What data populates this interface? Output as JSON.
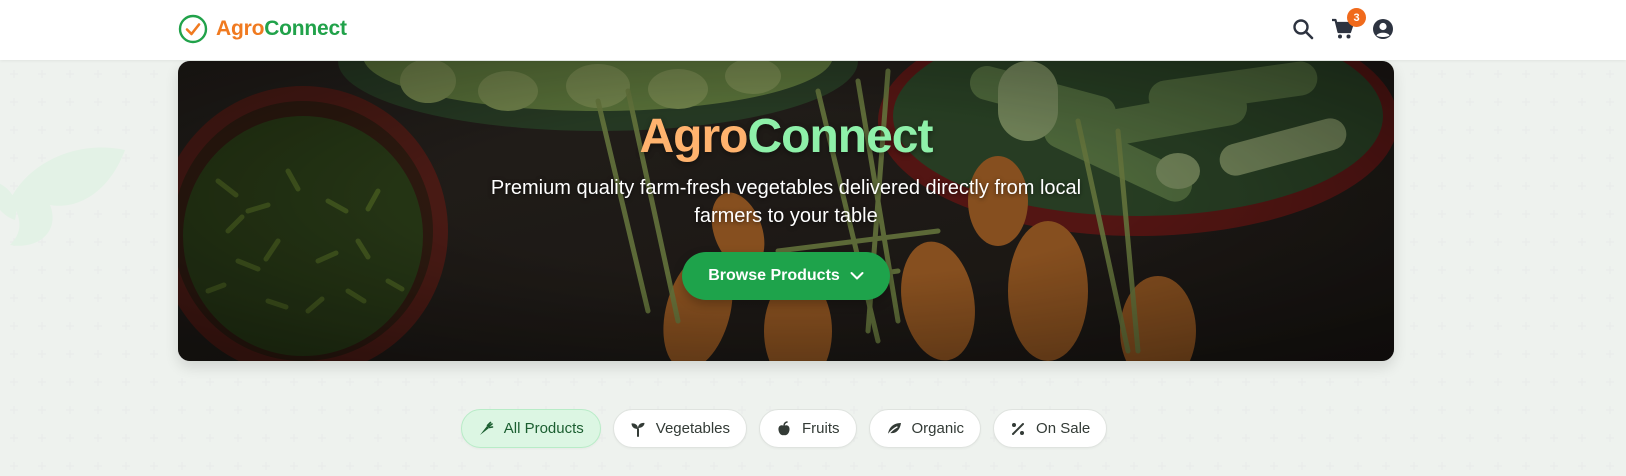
{
  "brand": {
    "name_part1": "Agro",
    "name_part2": "Connect",
    "accent_orange": "#f07a20",
    "accent_green": "#21a24a"
  },
  "header": {
    "icons": [
      "search-icon",
      "cart-icon",
      "user-account-icon"
    ],
    "cart_count": "3"
  },
  "hero": {
    "title_part1": "Agro",
    "title_part2": "Connect",
    "subtitle": "Premium quality farm-fresh vegetables delivered directly from local farmers to your table",
    "button_label": "Browse Products",
    "button_icon": "chevron-down-icon",
    "button_color": "#1ea34b"
  },
  "filters": {
    "items": [
      {
        "label": "All Products",
        "icon": "carrot-icon",
        "active": true
      },
      {
        "label": "Vegetables",
        "icon": "seedling-icon",
        "active": false
      },
      {
        "label": "Fruits",
        "icon": "apple-icon",
        "active": false
      },
      {
        "label": "Organic",
        "icon": "leaf-icon",
        "active": false
      },
      {
        "label": "On Sale",
        "icon": "percent-icon",
        "active": false
      }
    ]
  }
}
